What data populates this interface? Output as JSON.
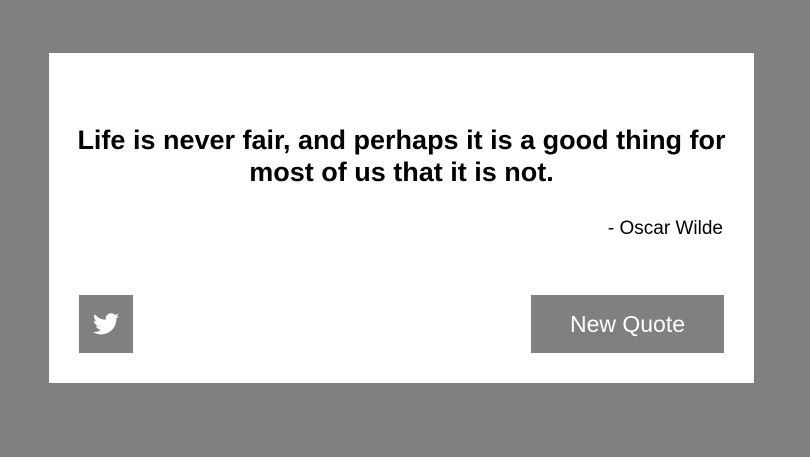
{
  "quote": {
    "text": "Life is never fair, and perhaps it is a good thing for most of us that it is not.",
    "author": "- Oscar Wilde"
  },
  "actions": {
    "tweet_icon": "twitter-icon",
    "new_quote_label": "New Quote"
  },
  "colors": {
    "background": "#808080",
    "card": "#ffffff",
    "button": "#808080",
    "button_text": "#ffffff",
    "text": "#000000"
  }
}
